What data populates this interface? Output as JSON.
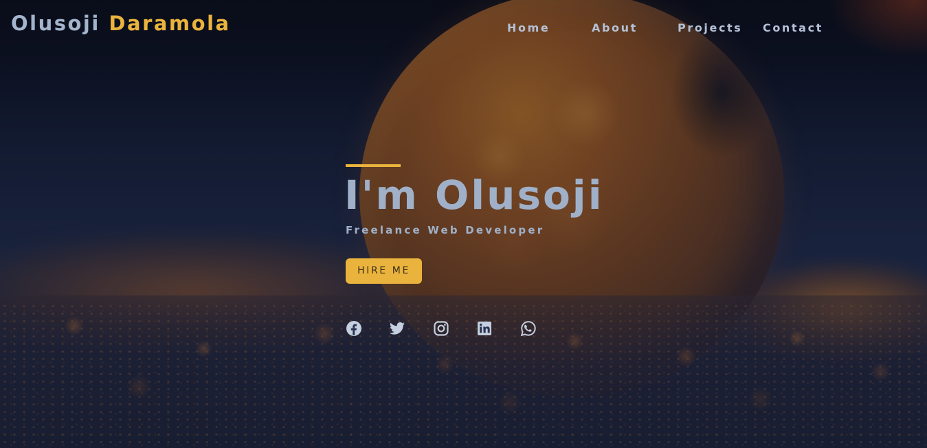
{
  "header": {
    "logo_first": "Olusoji",
    "logo_last": "Daramola",
    "nav": [
      {
        "label": "Home"
      },
      {
        "label": "About"
      },
      {
        "label": "Projects"
      },
      {
        "label": "Contact"
      }
    ]
  },
  "hero": {
    "headline": "I'm Olusoji",
    "subtitle": "Freelance Web Developer",
    "cta_label": "HIRE ME",
    "social_icons": [
      "facebook-icon",
      "twitter-icon",
      "instagram-icon",
      "linkedin-icon",
      "whatsapp-icon"
    ]
  },
  "colors": {
    "accent": "#eab33d",
    "text_light": "#a3b4cc",
    "overlay": "#121a30"
  }
}
